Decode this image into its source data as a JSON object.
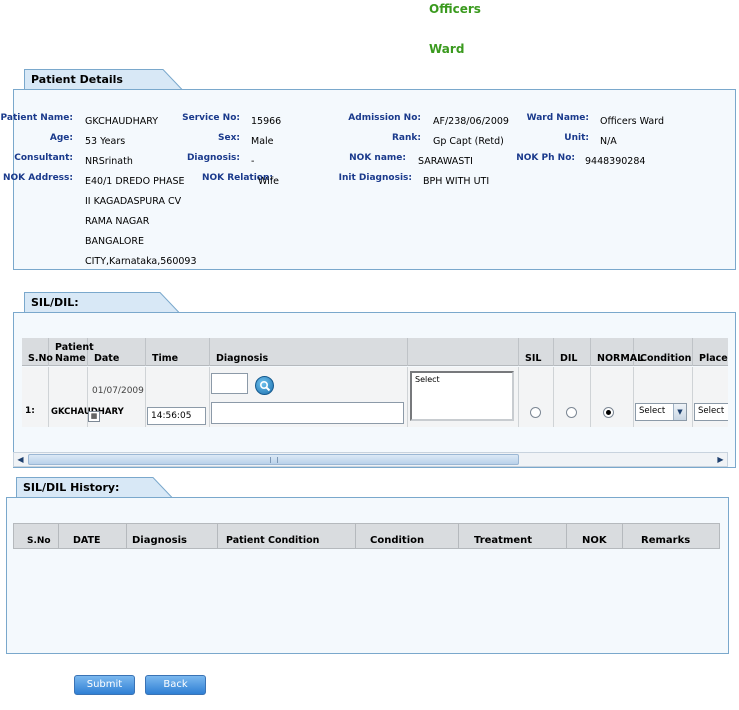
{
  "header": {
    "line1": "Officers",
    "line2": "Ward"
  },
  "patient_details": {
    "tab_label": "Patient Details",
    "labels": {
      "patient_name": "Patient Name:",
      "age": "Age:",
      "consultant": "Consultant:",
      "nok_address": "NOK Address:",
      "service_no": "Service No:",
      "sex": "Sex:",
      "diagnosis": "Diagnosis:",
      "nok_relation": "NOK Relation:",
      "admission_no": "Admission No:",
      "rank": "Rank:",
      "nok_name": "NOK name:",
      "init_diagnosis": "Init Diagnosis:",
      "ward_name": "Ward Name:",
      "unit": "Unit:",
      "nok_ph_no": "NOK Ph No:"
    },
    "values": {
      "patient_name": "GKCHAUDHARY",
      "age": "53 Years",
      "consultant": "NRSrinath",
      "nok_address_lines": [
        "E40/1 DREDO PHASE",
        "II KAGADASPURA CV",
        "RAMA NAGAR",
        "BANGALORE",
        "CITY,Karnataka,560093"
      ],
      "service_no": "15966",
      "sex": "Male",
      "diagnosis": "-",
      "nok_relation": "Wife",
      "admission_no": "AF/238/06/2009",
      "rank": "Gp Capt (Retd)",
      "nok_name": "SARAWASTI",
      "init_diagnosis": "BPH WITH UTI",
      "ward_name": "Officers Ward",
      "unit": "N/A",
      "nok_ph_no": "9448390284"
    }
  },
  "sil_dil": {
    "tab_label": "SIL/DIL:",
    "columns": [
      "S.No",
      "Patient Name",
      "Date",
      "Time",
      "Diagnosis",
      "",
      "SIL",
      "DIL",
      "NORMAL",
      "Condition",
      "Placed"
    ],
    "row": {
      "sno": "1:",
      "patient_name": "GKCHAUDHARY",
      "date": "01/07/2009",
      "time": "14:56:05",
      "diagnosis_list": "Select",
      "condition": "Select",
      "placed": "Select",
      "selected_status": "NORMAL"
    }
  },
  "history": {
    "tab_label": "SIL/DIL History:",
    "columns": [
      "S.No",
      "DATE",
      "Diagnosis",
      "Patient Condition",
      "Condition",
      "Treatment",
      "NOK",
      "Remarks"
    ]
  },
  "buttons": {
    "submit": "Submit",
    "back": "Back"
  }
}
